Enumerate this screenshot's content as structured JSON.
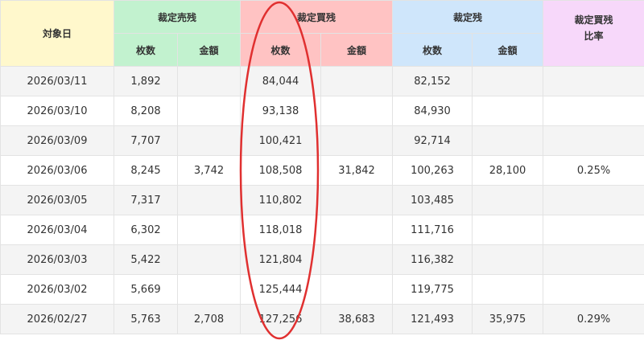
{
  "headers": {
    "date": "対象日",
    "sell_group": "裁定売残",
    "buy_group": "裁定買残",
    "balance_group": "裁定残",
    "ratio_line1": "裁定買残",
    "ratio_line2": "比率",
    "count": "枚数",
    "amount": "金額"
  },
  "colors": {
    "date_header": "#fff8cc",
    "sell_header": "#c2f2cf",
    "buy_header": "#ffc3c3",
    "balance_header": "#cfe6fb",
    "ratio_header": "#f7d8fa",
    "highlight_ellipse": "#e03030"
  },
  "rows": [
    {
      "date": "2026/03/11",
      "sell_count": "1,892",
      "sell_amount": "",
      "buy_count": "84,044",
      "buy_amount": "",
      "bal_count": "82,152",
      "bal_amount": "",
      "ratio": ""
    },
    {
      "date": "2026/03/10",
      "sell_count": "8,208",
      "sell_amount": "",
      "buy_count": "93,138",
      "buy_amount": "",
      "bal_count": "84,930",
      "bal_amount": "",
      "ratio": ""
    },
    {
      "date": "2026/03/09",
      "sell_count": "7,707",
      "sell_amount": "",
      "buy_count": "100,421",
      "buy_amount": "",
      "bal_count": "92,714",
      "bal_amount": "",
      "ratio": ""
    },
    {
      "date": "2026/03/06",
      "sell_count": "8,245",
      "sell_amount": "3,742",
      "buy_count": "108,508",
      "buy_amount": "31,842",
      "bal_count": "100,263",
      "bal_amount": "28,100",
      "ratio": "0.25%"
    },
    {
      "date": "2026/03/05",
      "sell_count": "7,317",
      "sell_amount": "",
      "buy_count": "110,802",
      "buy_amount": "",
      "bal_count": "103,485",
      "bal_amount": "",
      "ratio": ""
    },
    {
      "date": "2026/03/04",
      "sell_count": "6,302",
      "sell_amount": "",
      "buy_count": "118,018",
      "buy_amount": "",
      "bal_count": "111,716",
      "bal_amount": "",
      "ratio": ""
    },
    {
      "date": "2026/03/03",
      "sell_count": "5,422",
      "sell_amount": "",
      "buy_count": "121,804",
      "buy_amount": "",
      "bal_count": "116,382",
      "bal_amount": "",
      "ratio": ""
    },
    {
      "date": "2026/03/02",
      "sell_count": "5,669",
      "sell_amount": "",
      "buy_count": "125,444",
      "buy_amount": "",
      "bal_count": "119,775",
      "bal_amount": "",
      "ratio": ""
    },
    {
      "date": "2026/02/27",
      "sell_count": "5,763",
      "sell_amount": "2,708",
      "buy_count": "127,256",
      "buy_amount": "38,683",
      "bal_count": "121,493",
      "bal_amount": "35,975",
      "ratio": "0.29%"
    }
  ]
}
